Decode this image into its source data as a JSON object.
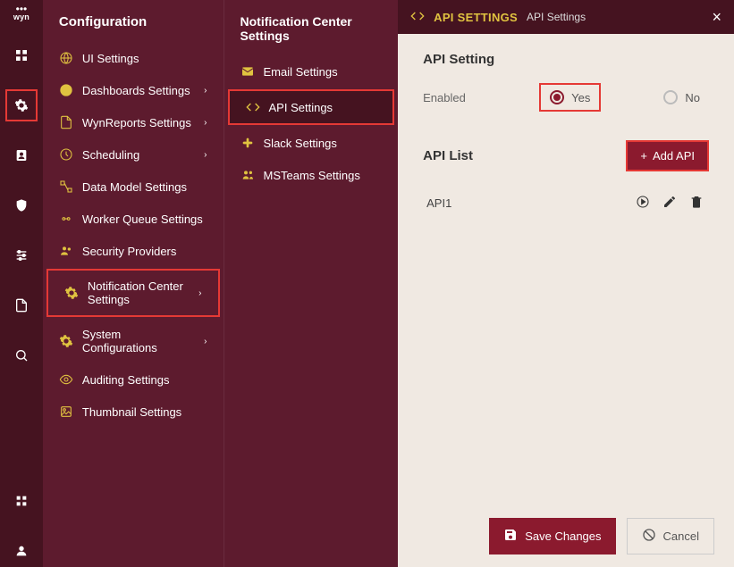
{
  "logo": "wyn",
  "rail": [
    "dashboard",
    "config",
    "contact",
    "security",
    "settings",
    "doc",
    "search",
    "apps",
    "user"
  ],
  "sidebar1": {
    "title": "Configuration",
    "items": [
      {
        "icon": "globe",
        "label": "UI Settings",
        "expand": false
      },
      {
        "icon": "pie",
        "label": "Dashboards Settings",
        "expand": true
      },
      {
        "icon": "doc",
        "label": "WynReports Settings",
        "expand": true
      },
      {
        "icon": "clock",
        "label": "Scheduling",
        "expand": true
      },
      {
        "icon": "model",
        "label": "Data Model Settings",
        "expand": false
      },
      {
        "icon": "queue",
        "label": "Worker Queue Settings",
        "expand": false
      },
      {
        "icon": "people",
        "label": "Security Providers",
        "expand": false
      },
      {
        "icon": "gear",
        "label": "Notification Center Settings",
        "expand": true,
        "hl": true
      },
      {
        "icon": "gear",
        "label": "System Configurations",
        "expand": true
      },
      {
        "icon": "eye",
        "label": "Auditing Settings",
        "expand": false
      },
      {
        "icon": "thumb",
        "label": "Thumbnail Settings",
        "expand": false
      }
    ]
  },
  "sidebar2": {
    "title": "Notification Center Settings",
    "items": [
      {
        "icon": "email",
        "label": "Email Settings"
      },
      {
        "icon": "code",
        "label": "API Settings",
        "hl": true
      },
      {
        "icon": "slack",
        "label": "Slack Settings"
      },
      {
        "icon": "teams",
        "label": "MSTeams Settings"
      }
    ]
  },
  "header": {
    "title": "API SETTINGS",
    "crumb": "API Settings"
  },
  "panel": {
    "sec_title": "API Setting",
    "enabled_label": "Enabled",
    "yes": "Yes",
    "no": "No",
    "list_title": "API List",
    "add_label": "Add API",
    "rows": [
      {
        "name": "API1"
      }
    ]
  },
  "footer": {
    "save": "Save Changes",
    "cancel": "Cancel"
  }
}
